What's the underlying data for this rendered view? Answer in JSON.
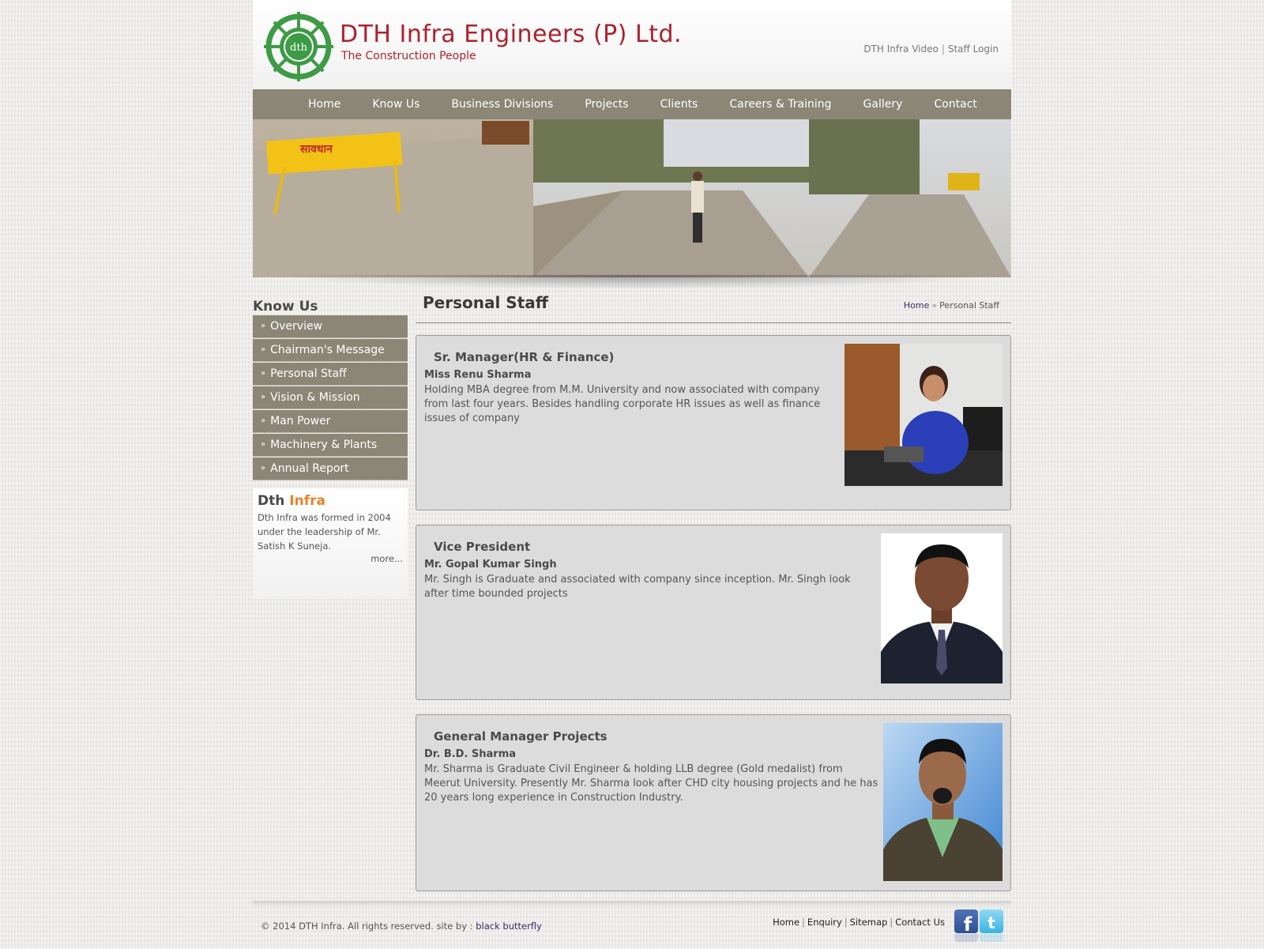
{
  "header": {
    "brand_title": "DTH Infra Engineers (P) Ltd.",
    "brand_tagline": "The Construction People",
    "logo_text": "dth",
    "top_links": [
      "DTH Infra Video",
      "Staff Login"
    ]
  },
  "nav": {
    "items": [
      "Home",
      "Know Us",
      "Business Divisions",
      "Projects",
      "Clients",
      "Careers & Training",
      "Gallery",
      "Contact"
    ]
  },
  "banner": {
    "sign_text": "सावधान"
  },
  "sidebar": {
    "title": "Know Us",
    "items": [
      "Overview",
      "Chairman's Message",
      "Personal Staff",
      "Vision & Mission",
      "Man Power",
      "Machinery & Plants",
      "Annual Report"
    ],
    "box": {
      "title_part1": "Dth",
      "title_part2": "Infra",
      "text": "Dth Infra was formed in 2004 under the leadership of Mr. Satish K Suneja.",
      "more_label": "more..."
    }
  },
  "content": {
    "page_title": "Personal Staff",
    "breadcrumb": {
      "home": "Home",
      "separator": "»",
      "current": "Personal Staff"
    },
    "staff": [
      {
        "role": "Sr. Manager(HR & Finance)",
        "name": "Miss Renu Sharma",
        "description": "Holding MBA degree from M.M. University and now associated with company from last four years. Besides handling corporate HR issues as well as finance issues of company"
      },
      {
        "role": "Vice President",
        "name": "Mr. Gopal Kumar Singh",
        "description": "Mr. Singh is Graduate and associated with company since inception. Mr. Singh look after time bounded projects"
      },
      {
        "role": "General Manager Projects",
        "name": "Dr. B.D. Sharma",
        "description": "Mr. Sharma is Graduate Civil Engineer & holding LLB degree (Gold medalist) from Meerut University. Presently Mr. Sharma look after CHD city housing projects and he has 20 years long experience in Construction Industry."
      }
    ]
  },
  "footer": {
    "copyright": "© 2014 DTH Infra. All rights reserved. site by :",
    "credit_link": "black butterfly",
    "links": [
      "Home",
      "Enquiry",
      "Sitemap",
      "Contact Us"
    ],
    "social": [
      "facebook-icon",
      "twitter-icon"
    ]
  },
  "colors": {
    "brand_red": "#b0202d",
    "logo_green": "#3d9a45",
    "nav_bg": "#8b8676",
    "accent_orange": "#e8832a",
    "card_bg": "#dcdcdc"
  }
}
